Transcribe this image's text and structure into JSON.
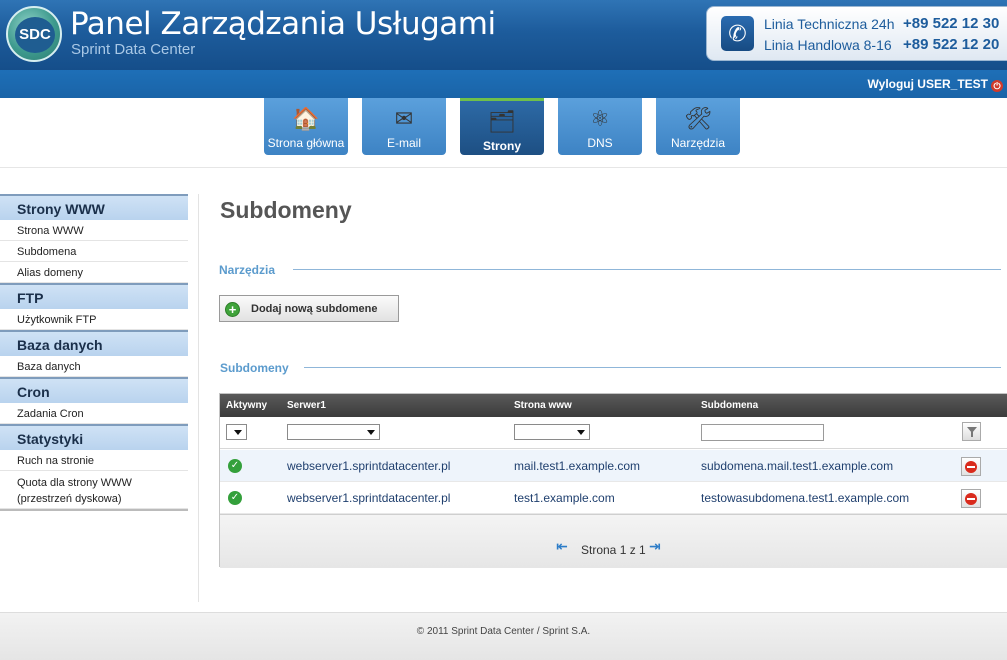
{
  "header": {
    "logo_text": "SDC",
    "title": "Panel Zarządzania Usługami",
    "subtitle": "Sprint Data Center",
    "contacts": [
      {
        "label": "Linia Techniczna 24h",
        "number": "+89 522 12 30"
      },
      {
        "label": "Linia Handlowa 8-16",
        "number": "+89 522 12 20"
      }
    ],
    "logout_label": "Wyloguj USER_TEST"
  },
  "nav": {
    "tabs": [
      {
        "label": "Strona główna",
        "icon": "home-icon",
        "glyph": "🏠"
      },
      {
        "label": "E-mail",
        "icon": "envelope-icon",
        "glyph": "✉"
      },
      {
        "label": "Strony",
        "icon": "pages-icon",
        "glyph": "🗂",
        "active": true
      },
      {
        "label": "DNS",
        "icon": "network-icon",
        "glyph": "⚛"
      },
      {
        "label": "Narzędzia",
        "icon": "tools-icon",
        "glyph": "🛠"
      }
    ]
  },
  "sidebar": {
    "sections": [
      {
        "title": "Strony WWW",
        "items": [
          "Strona WWW",
          "Subdomena",
          "Alias domeny"
        ]
      },
      {
        "title": "FTP",
        "items": [
          "Użytkownik FTP"
        ]
      },
      {
        "title": "Baza danych",
        "items": [
          "Baza danych"
        ]
      },
      {
        "title": "Cron",
        "items": [
          "Zadania Cron"
        ]
      },
      {
        "title": "Statystyki",
        "items": [
          "Ruch na stronie",
          "Quota dla strony WWW (przestrzeń dyskowa)"
        ]
      }
    ]
  },
  "main": {
    "page_title": "Subdomeny",
    "tools_section": "Narzędzia",
    "add_button": "Dodaj nową subdomene",
    "list_section": "Subdomeny"
  },
  "table": {
    "columns": [
      "Aktywny",
      "Serwer1",
      "Strona www",
      "Subdomena"
    ],
    "rows": [
      {
        "active": true,
        "server": "webserver1.sprintdatacenter.pl",
        "site": "mail.test1.example.com",
        "subdomain": "subdomena.mail.test1.example.com"
      },
      {
        "active": true,
        "server": "webserver1.sprintdatacenter.pl",
        "site": "test1.example.com",
        "subdomain": "testowasubdomena.test1.example.com"
      }
    ],
    "pager_text": "Strona 1 z 1"
  },
  "footer": {
    "text": "© 2011 Sprint Data Center / Sprint S.A."
  }
}
